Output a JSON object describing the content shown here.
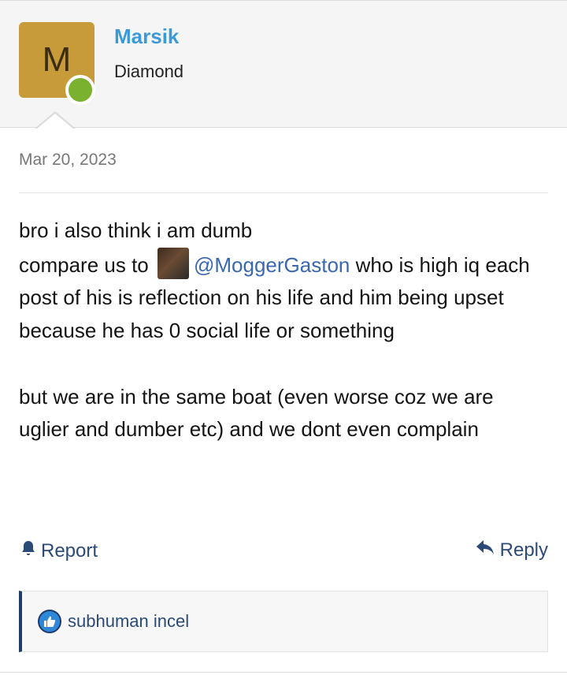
{
  "user": {
    "avatar_letter": "M",
    "name": "Marsik",
    "rank": "Diamond",
    "online_color": "#7ab22f"
  },
  "post": {
    "date": "Mar 20, 2023",
    "line1": "bro i also think i am dumb",
    "line2_prefix": "compare us to",
    "mention": "@MoggerGaston",
    "line2_suffix": " who is high iq each post of his is reflection on his life and him being upset because he has 0 social life or something",
    "paragraph2": "but we are in the same boat (even worse coz we are uglier and dumber etc) and we dont even complain"
  },
  "actions": {
    "report_label": "Report",
    "reply_label": "Reply"
  },
  "reactions": {
    "text": "subhuman incel",
    "icon": "thumbs-up-icon"
  },
  "colors": {
    "username": "#3a9ad9",
    "link": "#2c4a78",
    "avatar_bg": "#c89b3a"
  }
}
